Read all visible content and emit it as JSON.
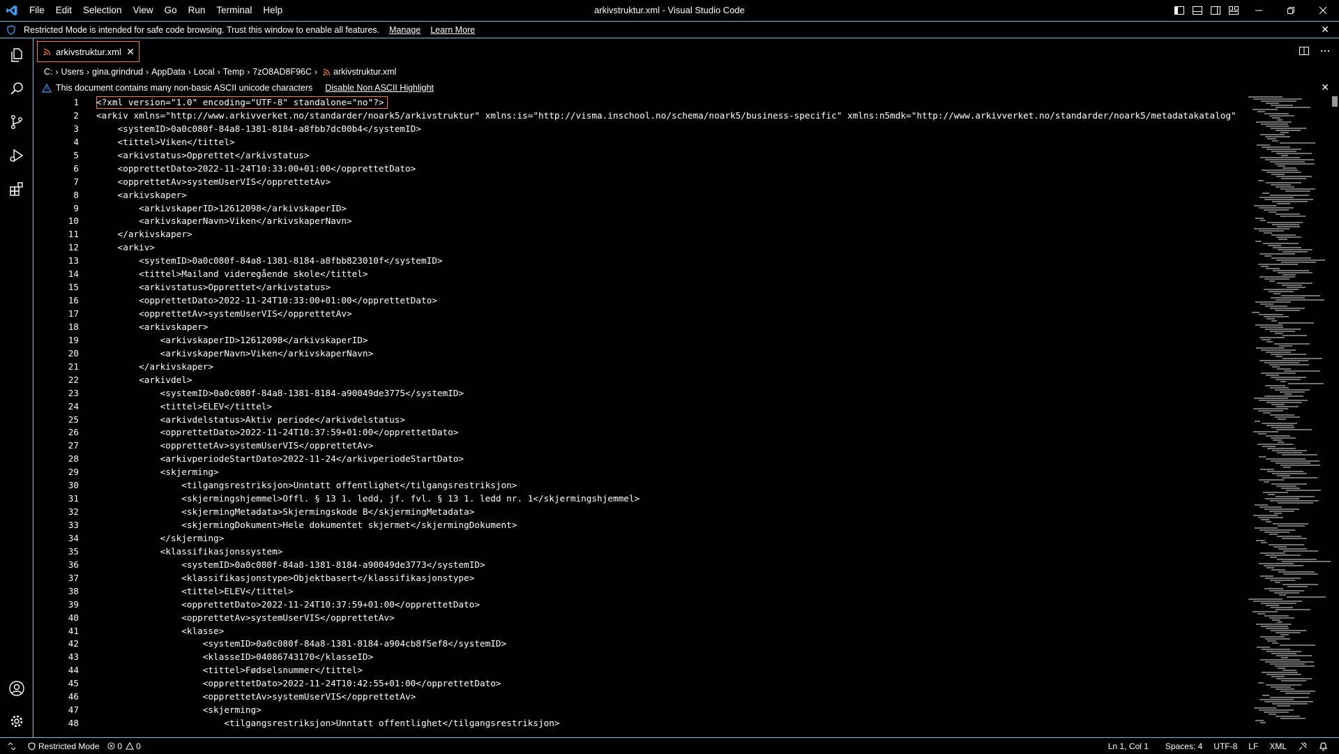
{
  "window": {
    "title": "arkivstruktur.xml - Visual Studio Code",
    "menu": [
      "File",
      "Edit",
      "Selection",
      "View",
      "Go",
      "Run",
      "Terminal",
      "Help"
    ]
  },
  "banner": {
    "message": "Restricted Mode is intended for safe code browsing. Trust this window to enable all features.",
    "manage_label": "Manage",
    "learn_more_label": "Learn More"
  },
  "tab": {
    "label": "arkivstruktur.xml"
  },
  "breadcrumb": [
    "C:",
    "Users",
    "gina.grindrud",
    "AppData",
    "Local",
    "Temp",
    "7zO8AD8F96C",
    "arkivstruktur.xml"
  ],
  "warning": {
    "text": "This document contains many non-basic ASCII unicode characters",
    "action_label": "Disable Non ASCII Highlight"
  },
  "editor": {
    "lines": [
      "<?xml version=\"1.0\" encoding=\"UTF-8\" standalone=\"no\"?>",
      "<arkiv xmlns=\"http://www.arkivverket.no/standarder/noark5/arkivstruktur\" xmlns:is=\"http://visma.inschool.no/schema/noark5/business-specific\" xmlns:n5mdk=\"http://www.arkivverket.no/standarder/noark5/metadatakatalog\"",
      "    <systemID>0a0c080f-84a8-1381-8184-a8fbb7dc00b4</systemID>",
      "    <tittel>Viken</tittel>",
      "    <arkivstatus>Opprettet</arkivstatus>",
      "    <opprettetDato>2022-11-24T10:33:00+01:00</opprettetDato>",
      "    <opprettetAv>systemUserVIS</opprettetAv>",
      "    <arkivskaper>",
      "        <arkivskaperID>12612098</arkivskaperID>",
      "        <arkivskaperNavn>Viken</arkivskaperNavn>",
      "    </arkivskaper>",
      "    <arkiv>",
      "        <systemID>0a0c080f-84a8-1381-8184-a8fbb823010f</systemID>",
      "        <tittel>Mailand videregående skole</tittel>",
      "        <arkivstatus>Opprettet</arkivstatus>",
      "        <opprettetDato>2022-11-24T10:33:00+01:00</opprettetDato>",
      "        <opprettetAv>systemUserVIS</opprettetAv>",
      "        <arkivskaper>",
      "            <arkivskaperID>12612098</arkivskaperID>",
      "            <arkivskaperNavn>Viken</arkivskaperNavn>",
      "        </arkivskaper>",
      "        <arkivdel>",
      "            <systemID>0a0c080f-84a8-1381-8184-a90049de3775</systemID>",
      "            <tittel>ELEV</tittel>",
      "            <arkivdelstatus>Aktiv periode</arkivdelstatus>",
      "            <opprettetDato>2022-11-24T10:37:59+01:00</opprettetDato>",
      "            <opprettetAv>systemUserVIS</opprettetAv>",
      "            <arkivperiodeStartDato>2022-11-24</arkivperiodeStartDato>",
      "            <skjerming>",
      "                <tilgangsrestriksjon>Unntatt offentlighet</tilgangsrestriksjon>",
      "                <skjermingshjemmel>Offl. § 13 1. ledd, jf. fvl. § 13 1. ledd nr. 1</skjermingshjemmel>",
      "                <skjermingMetadata>Skjermingskode B</skjermingMetadata>",
      "                <skjermingDokument>Hele dokumentet skjermet</skjermingDokument>",
      "            </skjerming>",
      "            <klassifikasjonssystem>",
      "                <systemID>0a0c080f-84a8-1381-8184-a90049de3773</systemID>",
      "                <klassifikasjonstype>Objektbasert</klassifikasjonstype>",
      "                <tittel>ELEV</tittel>",
      "                <opprettetDato>2022-11-24T10:37:59+01:00</opprettetDato>",
      "                <opprettetAv>systemUserVIS</opprettetAv>",
      "                <klasse>",
      "                    <systemID>0a0c080f-84a8-1381-8184-a904cb8f5ef8</systemID>",
      "                    <klasseID>04086743170</klasseID>",
      "                    <tittel>Fødselsnummer</tittel>",
      "                    <opprettetDato>2022-11-24T10:42:55+01:00</opprettetDato>",
      "                    <opprettetAv>systemUserVIS</opprettetAv>",
      "                    <skjerming>",
      "                        <tilgangsrestriksjon>Unntatt offentlighet</tilgangsrestriksjon>"
    ]
  },
  "statusbar": {
    "restricted_mode": "Restricted Mode",
    "errors": "0",
    "warnings": "0",
    "position": "Ln 1, Col 1",
    "spaces": "Spaces: 4",
    "encoding": "UTF-8",
    "eol": "LF",
    "language": "XML"
  },
  "colors": {
    "border": "#6fc3df",
    "focus": "#f38518",
    "background": "#000000",
    "rss": "#f38518"
  },
  "icons": [
    "vscode-logo-icon",
    "files-icon",
    "search-icon",
    "source-control-icon",
    "run-debug-icon",
    "extensions-icon",
    "account-icon",
    "settings-gear-icon",
    "shield-icon",
    "warning-icon",
    "split-editor-icon",
    "more-icon",
    "rss-icon",
    "remote-icon",
    "bell-icon",
    "feedback-icon"
  ]
}
